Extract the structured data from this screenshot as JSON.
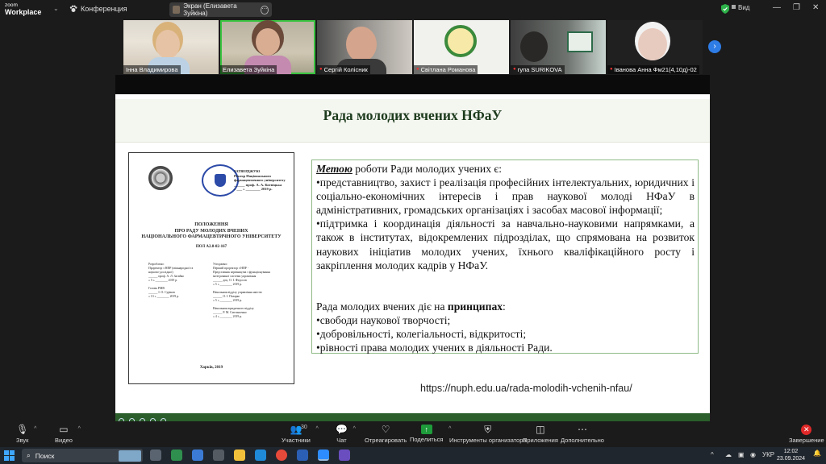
{
  "app": {
    "logo_line1": "zoom",
    "logo_line2": "Workplace",
    "conference_label": "Конференция",
    "screen_share_label": "Экран (Елизавета Зуйкіна)",
    "view_label": "Вид"
  },
  "participants": [
    {
      "name": "Інна Владимирова",
      "muted": false
    },
    {
      "name": "Елизавета Зуйкіна",
      "muted": false,
      "active": true
    },
    {
      "name": "Сергій Колісник",
      "muted": true
    },
    {
      "name": "Світлана Романова",
      "muted": true
    },
    {
      "name": "гупа SURIKOVA",
      "muted": true
    },
    {
      "name": "Іванова Анна Фм21(4,10д)-02",
      "muted": true
    }
  ],
  "slide": {
    "title": "Рада молодих вчених НФаУ",
    "document": {
      "approve": "ЗАТВЕРДЖУЮ\nРектор Національного\nфармацевтичного університету\n______ проф. А. А. Котвіцька\n« ___ » ________ 2019 р.",
      "title": "ПОЛОЖЕННЯ\nПРО РАДУ МОЛОДИХ ВЧЕНИХ\nНАЦІОНАЛЬНОГО ФАРМАЦЕВТИЧНОГО УНІВЕРСИТЕТУ",
      "code": "ПОЛ А2.8-02-167",
      "left_col": "Розроблено:\nПроректор з НПР (міжнародної та\nнауково-дослідної)\n______ проф. А. Л. Загайко\n« 5 » ________ 2019 р.\n\nГолова РМВ\n______ І. О. Суріков\n« 13 » ________ 2019 р.",
      "right_col": "Узгоджено:\nПерший проректор з НПР -\nПредставник керівництва з функціонування\nінтегрованої системи управління\n______ доц. О. І. Федосов\n« 5 » ________ 2019 р.\n\nНачальник відділу управління якістю\n______ О. І. Пазарко\n« 5 » ________ 2019 р.\n\nНачальник юридичного відділу\n______ Р. М. Смельшенко\n« 4 » ________ 2019 р.",
      "city": "Харків, 2019"
    },
    "text": {
      "goal_word": "Метою",
      "goal_rest": " роботи Ради молодих учених є:",
      "bullet1": "•представництво, захист і реалізація професійних інтелектуальних, юридичних і соціально-економічних інтересів і прав наукової молоді НФаУ в адміністративних, громадських організаціях і засобах масової інформації;",
      "bullet2": "•підтримка і координація діяльності за навчально-науковими напрямками, а також в інститутах, відокремлених підрозділах, що спрямована на розвиток наукових ініціатив молодих учених, їхнього кваліфікаційного росту і закріплення молодих кадрів у НФаУ.",
      "principles_pre": "Рада молодих вчених діє на ",
      "principles_word": "принципах",
      "principles_post": ":",
      "p1": "•свободи наукової творчості;",
      "p2": "•добровільності, колегіальності, відкритості;",
      "p3": "•рівності права молодих учених в діяльності Ради."
    },
    "link": "https://nuph.edu.ua/rada-molodih-vchenih-nfau/"
  },
  "toolbar": {
    "audio": "Звук",
    "video": "Видео",
    "participants": "Участники",
    "participants_count": "30",
    "chat": "Чат",
    "react": "Отреагировать",
    "share": "Поделиться",
    "host_tools": "Инструменты организатора",
    "apps": "Приложения",
    "more": "Дополнительно",
    "end": "Завершение"
  },
  "taskbar": {
    "search_placeholder": "Поиск",
    "lang": "УКР",
    "time": "12:02",
    "date": "23.09.2024"
  },
  "colors": {
    "accent_green": "#3ac341",
    "slide_green": "#2b5e2b",
    "end_red": "#e02828"
  }
}
